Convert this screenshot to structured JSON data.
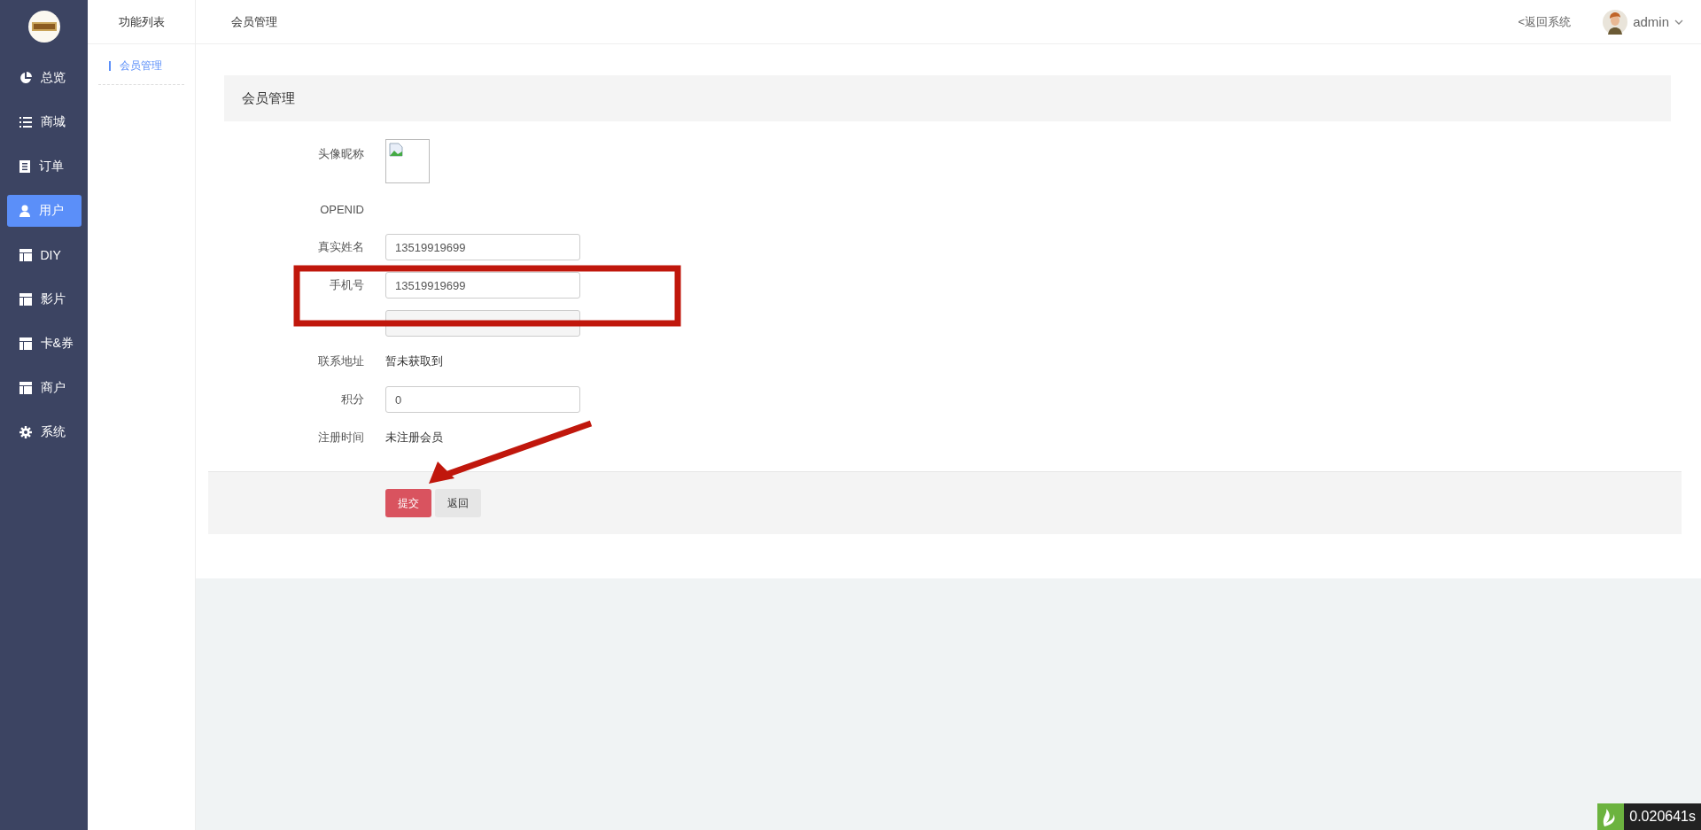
{
  "sidebar": {
    "items": [
      {
        "label": "总览",
        "kind": "pie",
        "selected": false
      },
      {
        "label": "商城",
        "kind": "list",
        "selected": false
      },
      {
        "label": "订单",
        "kind": "doc",
        "selected": false
      },
      {
        "label": "用户",
        "kind": "user",
        "selected": true
      },
      {
        "label": "DIY",
        "kind": "table",
        "selected": false
      },
      {
        "label": "影片",
        "kind": "table",
        "selected": false
      },
      {
        "label": "卡&券",
        "kind": "table",
        "selected": false
      },
      {
        "label": "商户",
        "kind": "table",
        "selected": false
      },
      {
        "label": "系统",
        "kind": "gear",
        "selected": false
      }
    ]
  },
  "subnav": {
    "title": "功能列表",
    "items": [
      {
        "label": "会员管理",
        "selected": true
      }
    ]
  },
  "header": {
    "title": "会员管理",
    "back_link": "<返回系统",
    "user": "admin"
  },
  "panel": {
    "title": "会员管理"
  },
  "form": [
    {
      "kind": "image",
      "label": "头像昵称"
    },
    {
      "kind": "text",
      "label": "OPENID"
    },
    {
      "kind": "input",
      "label": "真实姓名",
      "value": "13519919699"
    },
    {
      "kind": "input",
      "label": "手机号",
      "value": "13519919699"
    },
    {
      "kind": "disabled"
    },
    {
      "kind": "text",
      "label": "联系地址",
      "value": "暂未获取到"
    },
    {
      "kind": "input",
      "label": "积分",
      "value": "0"
    },
    {
      "kind": "text",
      "label": "注册时间",
      "value": "未注册会员"
    }
  ],
  "buttons": [
    {
      "label": "提交",
      "kind": "primary"
    },
    {
      "label": "返回",
      "kind": "default"
    }
  ],
  "timer": "0.020641s"
}
